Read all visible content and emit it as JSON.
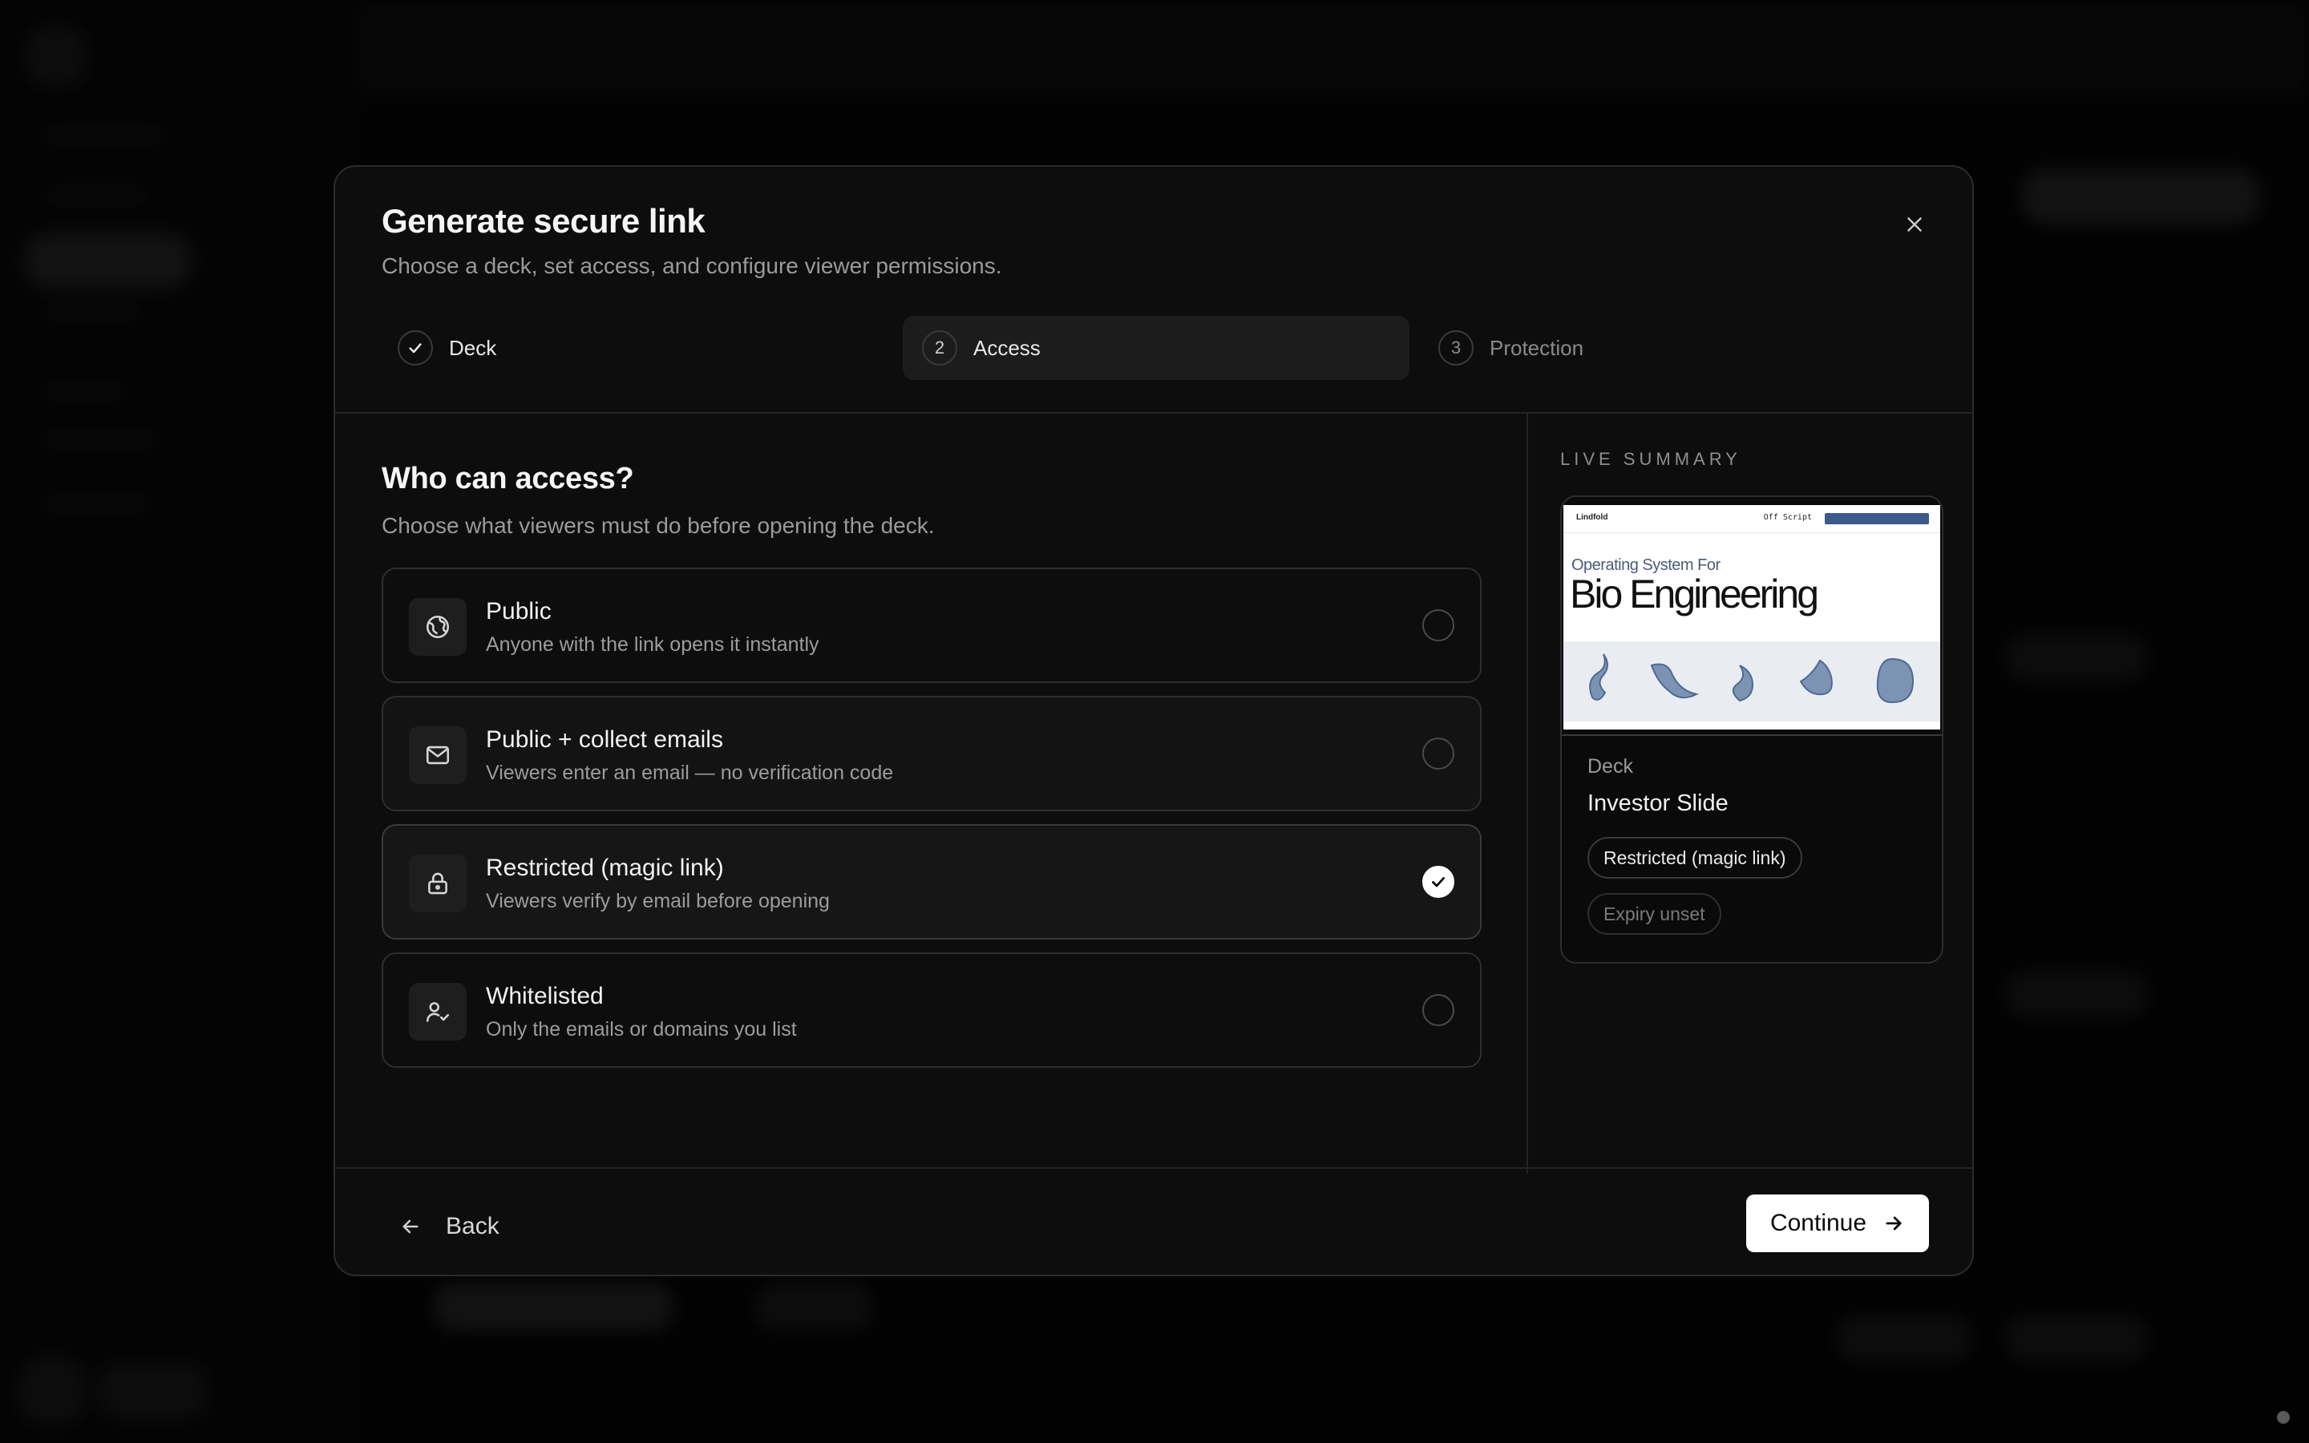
{
  "modal": {
    "title": "Generate secure link",
    "subtitle": "Choose a deck, set access, and configure viewer permissions."
  },
  "stepper": {
    "steps": [
      {
        "number": "1",
        "label": "Deck",
        "state": "complete"
      },
      {
        "number": "2",
        "label": "Access",
        "state": "active"
      },
      {
        "number": "3",
        "label": "Protection",
        "state": "upcoming"
      }
    ]
  },
  "access": {
    "title": "Who can access?",
    "subtitle": "Choose what viewers must do before opening the deck.",
    "options": [
      {
        "title": "Public",
        "description": "Anyone with the link opens it instantly",
        "icon": "globe-icon",
        "selected": false
      },
      {
        "title": "Public + collect emails",
        "description": "Viewers enter an email — no verification code",
        "icon": "mail-icon",
        "selected": false
      },
      {
        "title": "Restricted (magic link)",
        "description": "Viewers verify by email before opening",
        "icon": "lock-icon",
        "selected": true
      },
      {
        "title": "Whitelisted",
        "description": "Only the emails or domains you list",
        "icon": "user-check-icon",
        "selected": false
      }
    ]
  },
  "summary": {
    "label": "LIVE SUMMARY",
    "thumbnail": {
      "logo_text": "Lindfold",
      "nav_text": "Off Script",
      "kicker": "Operating System For",
      "headline": "Bio Engineering"
    },
    "deck_label": "Deck",
    "deck_name": "Investor Slide",
    "access_pill": "Restricted (magic link)",
    "expiry_pill": "Expiry unset"
  },
  "footer": {
    "back_label": "Back",
    "continue_label": "Continue"
  },
  "colors": {
    "background": "#050505",
    "modal": "#0d0d0d",
    "accent": "#ffffff",
    "muted_text": "#9a9a9a"
  }
}
